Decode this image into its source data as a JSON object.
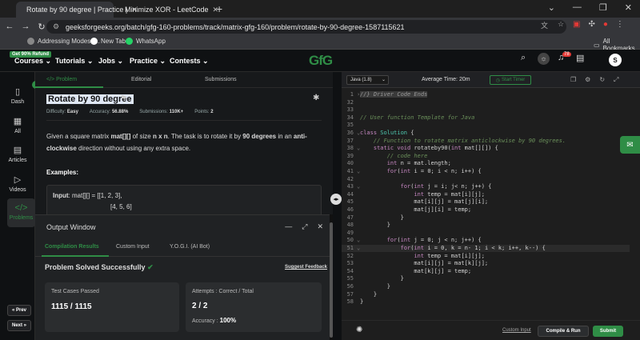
{
  "browser": {
    "tabs": [
      {
        "title": "Rotate by 90 degree | Practice |",
        "active": true
      },
      {
        "title": "Minimize XOR - LeetCode",
        "active": false
      }
    ],
    "new_tab": "+",
    "window_controls": [
      "⌄",
      "—",
      "❐",
      "✕"
    ],
    "url": "geeksforgeeks.org/batch/gfg-160-problems/track/matrix-gfg-160/problem/rotate-by-90-degree-1587115621",
    "bookmarks": [
      {
        "label": "Addressing Modes -...",
        "icon": "globe-icon"
      },
      {
        "label": "New Tab",
        "icon": "google-icon"
      },
      {
        "label": "WhatsApp",
        "icon": "whatsapp-icon"
      }
    ],
    "all_bookmarks": "All Bookmarks"
  },
  "gfg_nav": {
    "refund_badge": "Get 90% Refund",
    "items": [
      "Courses ⌄",
      "Tutorials ⌄",
      "Jobs ⌄",
      "Practice ⌄",
      "Contests ⌄"
    ],
    "logo": "GfG",
    "notification_count": "78",
    "avatar_letter": "S"
  },
  "rail": {
    "items": [
      "Dash",
      "All",
      "Articles",
      "Videos",
      "Problems"
    ],
    "prev": "« Prev",
    "next": "Next »"
  },
  "problem": {
    "tabs": [
      "</> Problem",
      "Editorial",
      "Submissions"
    ],
    "title": "Rotate by 90 degree",
    "difficulty_label": "Difficulty:",
    "difficulty": "Easy",
    "accuracy_label": "Accuracy:",
    "accuracy": "56.88%",
    "submissions_label": "Submissions:",
    "submissions": "110K+",
    "points_label": "Points:",
    "points": "2",
    "desc_1": "Given a square matrix ",
    "desc_mat": "mat[][]",
    "desc_2": " of size ",
    "desc_nxn": "n x n",
    "desc_3": ". The task is to rotate it by ",
    "desc_deg": "90 degrees",
    "desc_4": " in an ",
    "desc_anti": "anti-clockwise",
    "desc_5": " direction without using any extra space.",
    "examples": "Examples:",
    "input_label": "Input",
    "input_line1": ":  mat[][] = [[1,  2,  3],",
    "input_line2": "[4,  5,  6]"
  },
  "output": {
    "title": "Output Window",
    "tabs": [
      "Compilation Results",
      "Custom Input",
      "Y.O.G.I. (AI Bot)"
    ],
    "status": "Problem Solved Successfully",
    "suggest": "Suggest Feedback",
    "tests_label": "Test Cases Passed",
    "tests_value": "1115 / 1115",
    "attempts_label": "Attempts : Correct / Total",
    "attempts_value": "2 / 2",
    "accuracy_label": "Accuracy :",
    "accuracy_value": "100%"
  },
  "editor": {
    "language": "Java (1.8)",
    "avg_time": "Average Time: 20m",
    "start_timer": "Start Timer",
    "lines": [
      {
        "n": "1",
        "t": "//} Driver Code Ends",
        "c": "cm",
        "a": "›"
      },
      {
        "n": "32",
        "t": "",
        "c": "",
        "a": ""
      },
      {
        "n": "33",
        "t": "",
        "c": "",
        "a": ""
      },
      {
        "n": "34",
        "t": "// User function Template for Java",
        "c": "cm",
        "a": ""
      },
      {
        "n": "35",
        "t": "",
        "c": "",
        "a": ""
      },
      {
        "n": "36",
        "t": "class Solution {",
        "c": "",
        "a": "⌄"
      },
      {
        "n": "37",
        "t": "    // Function to rotate matrix anticlockwise by 90 degrees.",
        "c": "cm",
        "a": ""
      },
      {
        "n": "38",
        "t": "    static void rotateby90(int mat[][]) {",
        "c": "",
        "a": "⌄"
      },
      {
        "n": "39",
        "t": "        // code here",
        "c": "cm",
        "a": ""
      },
      {
        "n": "40",
        "t": "        int n = mat.length;",
        "c": "",
        "a": ""
      },
      {
        "n": "41",
        "t": "        for(int i = 0; i < n; i++) {",
        "c": "",
        "a": "⌄"
      },
      {
        "n": "42",
        "t": "",
        "c": "",
        "a": ""
      },
      {
        "n": "43",
        "t": "            for(int j = i; j< n; j++) {",
        "c": "",
        "a": "⌄"
      },
      {
        "n": "44",
        "t": "                int temp = mat[i][j];",
        "c": "",
        "a": ""
      },
      {
        "n": "45",
        "t": "                mat[i][j] = mat[j][i];",
        "c": "",
        "a": ""
      },
      {
        "n": "46",
        "t": "                mat[j][i] = temp;",
        "c": "",
        "a": ""
      },
      {
        "n": "47",
        "t": "            }",
        "c": "",
        "a": ""
      },
      {
        "n": "48",
        "t": "        }",
        "c": "",
        "a": ""
      },
      {
        "n": "49",
        "t": "",
        "c": "",
        "a": ""
      },
      {
        "n": "50",
        "t": "        for(int j = 0; j < n; j++) {",
        "c": "",
        "a": "⌄"
      },
      {
        "n": "51",
        "t": "            for(int i = 0, k = n- 1; i < k; i++, k--) {",
        "c": "",
        "a": "⌄"
      },
      {
        "n": "52",
        "t": "                int temp = mat[i][j];",
        "c": "",
        "a": ""
      },
      {
        "n": "53",
        "t": "                mat[i][j] = mat[k][j];",
        "c": "",
        "a": ""
      },
      {
        "n": "54",
        "t": "                mat[k][j] = temp;",
        "c": "",
        "a": ""
      },
      {
        "n": "55",
        "t": "            }",
        "c": "",
        "a": ""
      },
      {
        "n": "56",
        "t": "        }",
        "c": "",
        "a": ""
      },
      {
        "n": "57",
        "t": "    }",
        "c": "",
        "a": ""
      },
      {
        "n": "58",
        "t": "}",
        "c": "",
        "a": ""
      }
    ],
    "highlight_line": "51",
    "custom_input": "Custom Input",
    "compile_run": "Compile & Run",
    "submit": "Submit"
  },
  "colors": {
    "accent": "#2f8d46",
    "background": "#0f1113",
    "panel": "#17191b"
  }
}
